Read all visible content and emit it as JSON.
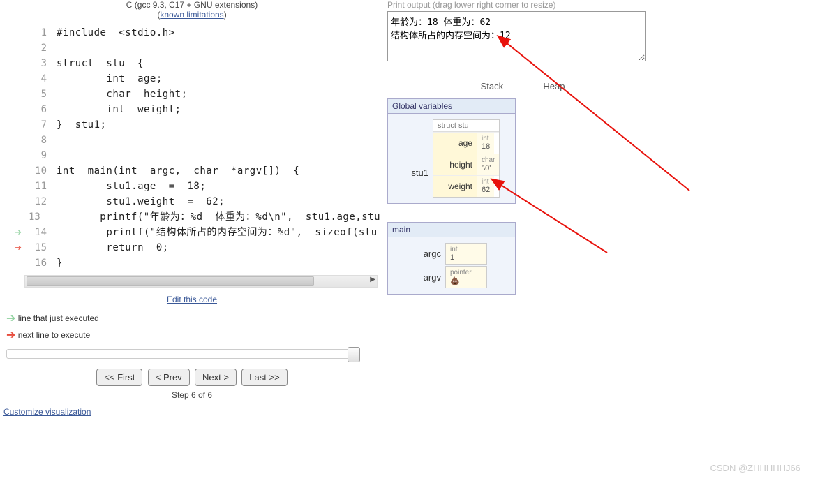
{
  "header": {
    "compiler": "C (gcc 9.3, C17 + GNU extensions)",
    "limitations_link": "known limitations"
  },
  "code": {
    "lines": [
      "#include  <stdio.h>",
      "",
      "struct  stu  {",
      "        int  age;",
      "        char  height;",
      "        int  weight;",
      "}  stu1;",
      "",
      "",
      "int  main(int  argc,  char  *argv[])  {",
      "        stu1.age  =  18;",
      "        stu1.weight  =  62;",
      "        printf(\"年龄为：%d  体重为：%d\\n\",  stu1.age,stu",
      "        printf(\"结构体所占的内存空间为：%d\",  sizeof(stu",
      "        return  0;",
      "}"
    ],
    "prev_line_index": 13,
    "next_line_index": 14
  },
  "edit_link": "Edit this code",
  "legend": {
    "prev": "line that just executed",
    "next": "next line to execute"
  },
  "controls": {
    "first": "<< First",
    "prev": "< Prev",
    "next": "Next >",
    "last": "Last >>",
    "step_text": "Step 6 of 6"
  },
  "customize_link": "Customize visualization",
  "output": {
    "label": "Print output (drag lower right corner to resize)",
    "text": "年龄为：18 体重为：62\n结构体所占的内存空间为：12"
  },
  "columns": {
    "stack": "Stack",
    "heap": "Heap"
  },
  "globals": {
    "title": "Global variables",
    "var_name": "stu1",
    "struct_type": "struct stu",
    "fields": [
      {
        "name": "age",
        "type": "int",
        "value": "18"
      },
      {
        "name": "height",
        "type": "char",
        "value": "'\\0'"
      },
      {
        "name": "weight",
        "type": "int",
        "value": "62"
      }
    ]
  },
  "main_frame": {
    "title": "main",
    "vars": [
      {
        "name": "argc",
        "type": "int",
        "value": "1"
      },
      {
        "name": "argv",
        "type": "pointer",
        "value": "💩"
      }
    ]
  },
  "watermark": "CSDN @ZHHHHHJ66"
}
